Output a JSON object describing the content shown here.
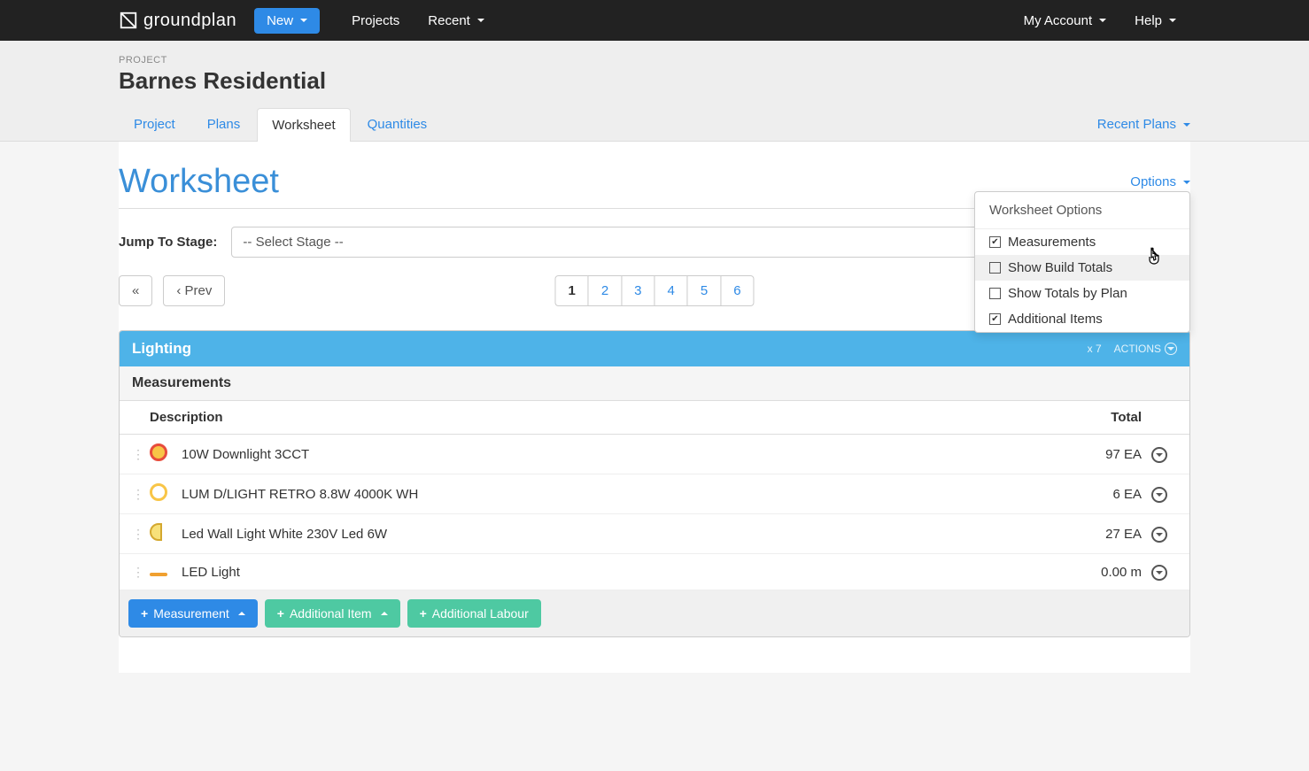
{
  "navbar": {
    "brand": "groundplan",
    "new_label": "New",
    "links": [
      "Projects",
      "Recent"
    ],
    "right": [
      "My Account",
      "Help"
    ]
  },
  "header": {
    "project_label": "PROJECT",
    "project_title": "Barnes Residential",
    "tabs": [
      "Project",
      "Plans",
      "Worksheet",
      "Quantities"
    ],
    "active_tab": "Worksheet",
    "recent_plans": "Recent Plans"
  },
  "page": {
    "title": "Worksheet",
    "options_label": "Options",
    "jump_label": "Jump To Stage:",
    "stage_placeholder": "-- Select Stage --",
    "prev_label": "Prev",
    "pages": [
      "1",
      "2",
      "3",
      "4",
      "5",
      "6"
    ],
    "active_page": "1"
  },
  "dropdown": {
    "title": "Worksheet Options",
    "items": [
      {
        "label": "Measurements",
        "checked": true
      },
      {
        "label": "Show Build Totals",
        "checked": false
      },
      {
        "label": "Show Totals by Plan",
        "checked": false
      },
      {
        "label": "Additional Items",
        "checked": true
      }
    ]
  },
  "section": {
    "title": "Lighting",
    "badge": "x 7",
    "actions_label": "ACTIONS",
    "sub": "Measurements",
    "columns": {
      "desc": "Description",
      "total": "Total"
    },
    "rows": [
      {
        "desc": "10W Downlight 3CCT",
        "total": "97 EA"
      },
      {
        "desc": "LUM D/LIGHT RETRO 8.8W 4000K WH",
        "total": "6 EA"
      },
      {
        "desc": "Led Wall Light White 230V Led 6W",
        "total": "27 EA"
      },
      {
        "desc": "LED Light",
        "total": "0.00 m"
      }
    ],
    "buttons": {
      "measurement": "Measurement",
      "additional_item": "Additional Item",
      "additional_labour": "Additional Labour"
    }
  }
}
